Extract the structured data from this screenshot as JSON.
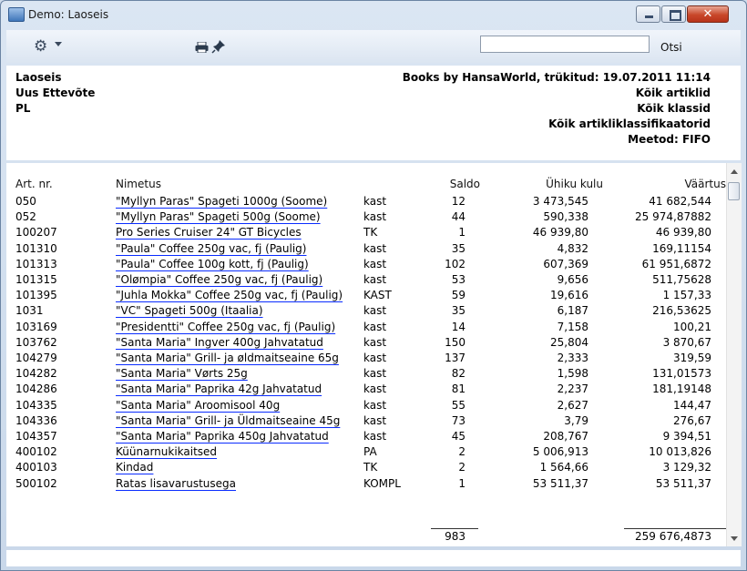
{
  "window": {
    "title": "Demo: Laoseis"
  },
  "toolbar": {
    "search_placeholder": "",
    "search_button": "Otsi",
    "gear_icon": "gear-icon",
    "print_icon": "printer-icon",
    "pin_icon": "pushpin-icon"
  },
  "header": {
    "left": [
      "Laoseis",
      "Uus Ettevõte",
      "PL"
    ],
    "right": [
      "Books by HansaWorld, trükitud: 19.07.2011 11:14",
      "Kõik artiklid",
      "Kõik klassid",
      "Kõik artikliklassifikaatorid",
      "Meetod: FIFO"
    ]
  },
  "columns": {
    "art": "Art. nr.",
    "name": "Nimetus",
    "saldo": "Saldo",
    "unit_cost": "Ühiku kulu",
    "value": "Väärtus"
  },
  "rows": [
    {
      "art": "050",
      "name": "\"Myllyn Paras\" Spageti 1000g  (Soome)",
      "unit": "kast",
      "saldo": "12",
      "unit_cost": "3 473,545",
      "value": "41 682,544"
    },
    {
      "art": "052",
      "name": "\"Myllyn Paras\" Spageti 500g  (Soome)",
      "unit": "kast",
      "saldo": "44",
      "unit_cost": "590,338",
      "value": "25 974,87882"
    },
    {
      "art": "100207",
      "name": "Pro Series Cruiser 24\"  GT Bicycles",
      "unit": "TK",
      "saldo": "1",
      "unit_cost": "46 939,80",
      "value": "46 939,80"
    },
    {
      "art": "101310",
      "name": "\"Paula\" Coffee 250g vac, fj  (Paulig)",
      "unit": "kast",
      "saldo": "35",
      "unit_cost": "4,832",
      "value": "169,11154"
    },
    {
      "art": "101313",
      "name": "\"Paula\" Coffee 100g kott, fj  (Paulig)",
      "unit": "kast",
      "saldo": "102",
      "unit_cost": "607,369",
      "value": "61 951,6872"
    },
    {
      "art": "101315",
      "name": "\"Olømpia\" Coffee 250g vac, fj  (Paulig)",
      "unit": "kast",
      "saldo": "53",
      "unit_cost": "9,656",
      "value": "511,75628"
    },
    {
      "art": "101395",
      "name": "\"Juhla Mokka\" Coffee 250g vac, fj  (Paulig)",
      "unit": "KAST",
      "saldo": "59",
      "unit_cost": "19,616",
      "value": "1 157,33"
    },
    {
      "art": "1031",
      "name": "\"VC\" Spageti    500g  (Itaalia)",
      "unit": "kast",
      "saldo": "35",
      "unit_cost": "6,187",
      "value": "216,53625"
    },
    {
      "art": "103169",
      "name": "\"Presidentti\" Coffee 250g vac, fj  (Paulig)",
      "unit": "kast",
      "saldo": "14",
      "unit_cost": "7,158",
      "value": "100,21"
    },
    {
      "art": "103762",
      "name": "\"Santa Maria\" Ingver  400g  Jahvatatud",
      "unit": "kast",
      "saldo": "150",
      "unit_cost": "25,804",
      "value": "3 870,67"
    },
    {
      "art": "104279",
      "name": "\"Santa Maria\" Grill- ja øldmaitseaine  65g",
      "unit": "kast",
      "saldo": "137",
      "unit_cost": "2,333",
      "value": "319,59"
    },
    {
      "art": "104282",
      "name": "\"Santa Maria\" Vørts  25g",
      "unit": "kast",
      "saldo": "82",
      "unit_cost": "1,598",
      "value": "131,01573"
    },
    {
      "art": "104286",
      "name": "\"Santa Maria\" Paprika  42g  Jahvatatud",
      "unit": "kast",
      "saldo": "81",
      "unit_cost": "2,237",
      "value": "181,19148"
    },
    {
      "art": "104335",
      "name": "\"Santa Maria\" Aroomisool  40g",
      "unit": "kast",
      "saldo": "55",
      "unit_cost": "2,627",
      "value": "144,47"
    },
    {
      "art": "104336",
      "name": "\"Santa Maria\" Grill- ja Üldmaitseaine  45g",
      "unit": "kast",
      "saldo": "73",
      "unit_cost": "3,79",
      "value": "276,67"
    },
    {
      "art": "104357",
      "name": "\"Santa Maria\" Paprika  450g  Jahvatatud",
      "unit": "kast",
      "saldo": "45",
      "unit_cost": "208,767",
      "value": "9 394,51"
    },
    {
      "art": "400102",
      "name": "Küünarnukikaitsed",
      "unit": "PA",
      "saldo": "2",
      "unit_cost": "5 006,913",
      "value": "10 013,826"
    },
    {
      "art": "400103",
      "name": "Kindad",
      "unit": "TK",
      "saldo": "2",
      "unit_cost": "1 564,66",
      "value": "3 129,32"
    },
    {
      "art": "500102",
      "name": "Ratas lisavarustusega",
      "unit": "KOMPL",
      "saldo": "1",
      "unit_cost": "53 511,37",
      "value": "53 511,37"
    }
  ],
  "totals": {
    "saldo": "983",
    "value": "259 676,4873"
  }
}
